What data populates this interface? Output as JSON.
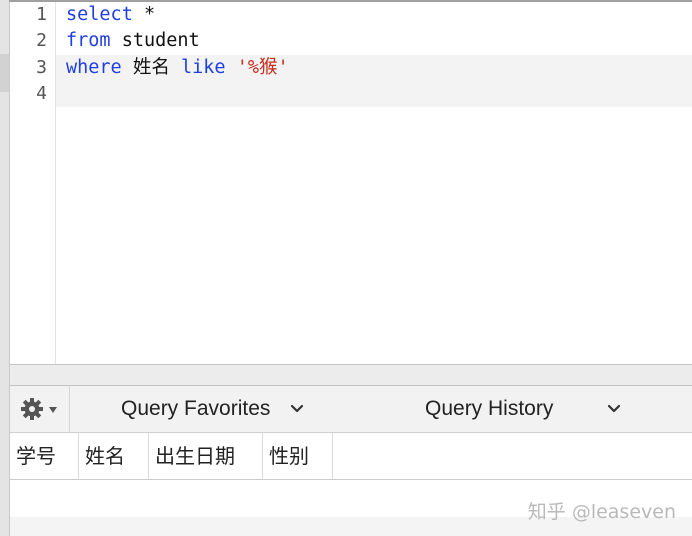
{
  "editor": {
    "line_numbers": [
      "1",
      "2",
      "3",
      "4"
    ],
    "lines": [
      [
        {
          "t": "select",
          "c": "kw"
        },
        {
          "t": " *",
          "c": "plain"
        }
      ],
      [
        {
          "t": "from",
          "c": "kw"
        },
        {
          "t": " student",
          "c": "plain"
        }
      ],
      [
        {
          "t": "where",
          "c": "kw"
        },
        {
          "t": " 姓名 ",
          "c": "plain"
        },
        {
          "t": "like",
          "c": "kw"
        },
        {
          "t": " ",
          "c": "plain"
        },
        {
          "t": "'%猴'",
          "c": "str"
        }
      ],
      []
    ]
  },
  "toolbar": {
    "gear_icon": "gear-icon",
    "query_favorites_label": "Query Favorites",
    "query_history_label": "Query History"
  },
  "results": {
    "columns": [
      "学号",
      "姓名",
      "出生日期",
      "性别"
    ]
  },
  "watermark": {
    "text": "知乎 @leaseven"
  },
  "colors": {
    "keyword": "#1f3fe0",
    "string": "#c62b1a",
    "text": "#111111"
  }
}
